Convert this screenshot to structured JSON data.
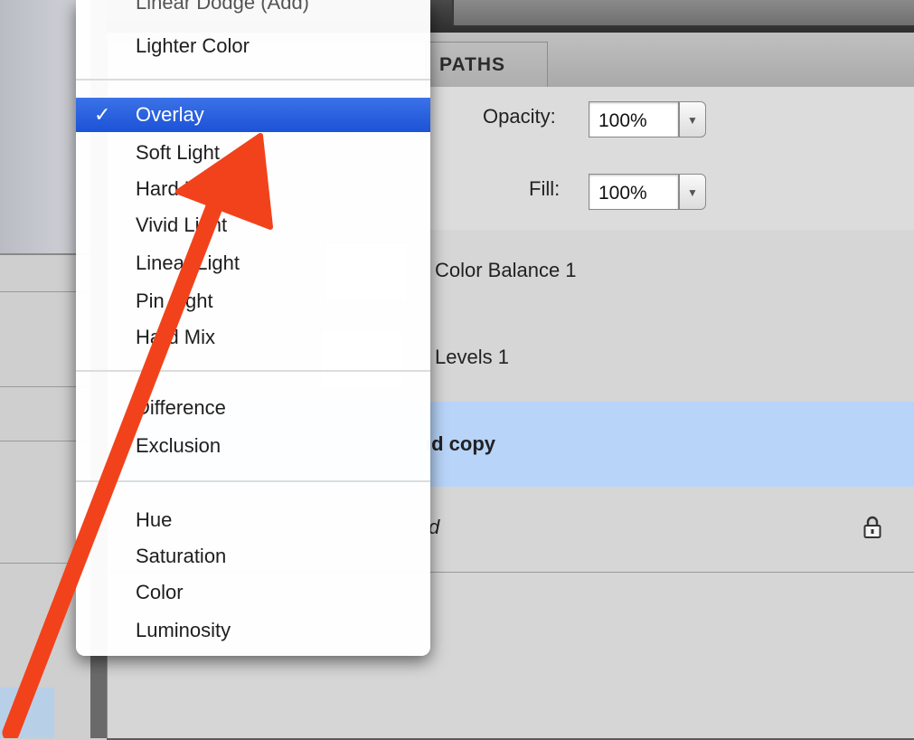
{
  "tabs": {
    "paths_label": "PATHS"
  },
  "options_row": {
    "opacity_label": "Opacity:",
    "opacity_value": "100%",
    "fill_label": "Fill:",
    "fill_value": "100%",
    "stepper_glyph": "⬍"
  },
  "layers": [
    {
      "name": "Color Balance 1"
    },
    {
      "name": "Levels 1"
    },
    {
      "name": "ıd copy"
    },
    {
      "name": "d"
    }
  ],
  "blend_menu": {
    "partial_top_item": "Linear Dodge (Add)",
    "check_mark": "✓",
    "groups": [
      [
        "Lighter Color"
      ],
      [
        "Overlay",
        "Soft Light",
        "Hard Light",
        "Vivid Light",
        "Linear Light",
        "Pin Light",
        "Hard Mix"
      ],
      [
        "Difference",
        "Exclusion"
      ],
      [
        "Hue",
        "Saturation",
        "Color",
        "Luminosity"
      ]
    ],
    "selected": "Overlay"
  },
  "icons": {
    "lock": "lock-icon",
    "dropdown": "triangle-down-icon",
    "stepper": "up-down-stepper-icon"
  },
  "colors": {
    "menu_highlight": "#1c52d6",
    "selected_layer": "#b8d4f9",
    "annotation_arrow": "#f2421c"
  }
}
